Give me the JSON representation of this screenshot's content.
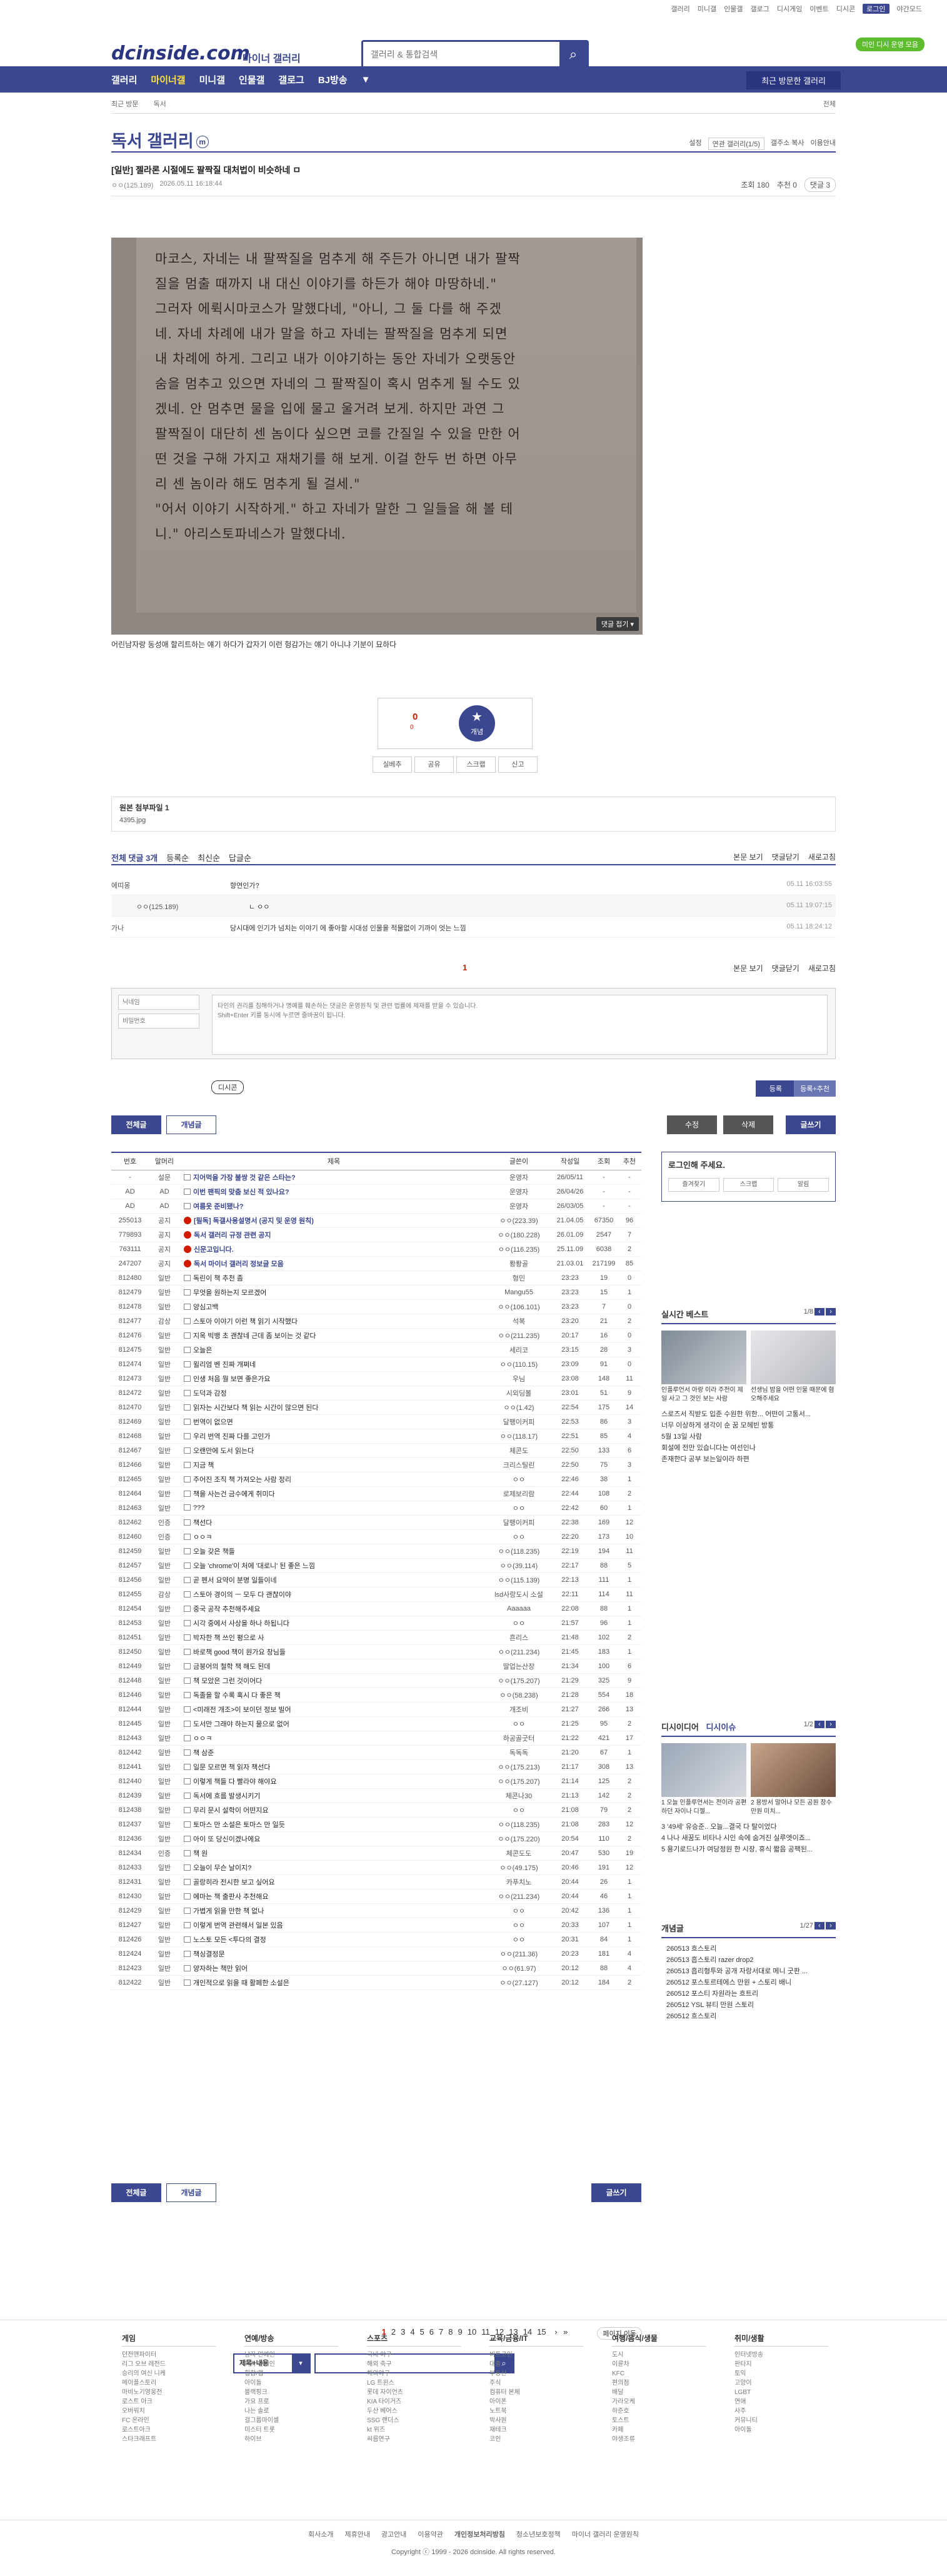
{
  "util_links": [
    "갤러리",
    "미니갤",
    "인물갤",
    "갤로그",
    "디시게임",
    "이벤트",
    "디시콘",
    "로그인",
    "야간모드"
  ],
  "header": {
    "logo": "dcinside.com",
    "logo_sub": "마이너 갤러리",
    "search_placeholder": "갤러리 & 통합검색",
    "promo": "미인 디시 운영 모음"
  },
  "gnb": {
    "items": [
      "갤러리",
      "마이너갤",
      "미니갤",
      "인물갤",
      "갤로그",
      "BJ방송",
      "▼"
    ],
    "recent": "최근 방문한 갤러리"
  },
  "lnb": {
    "crumb1": "최근 방문",
    "crumb2": "독서",
    "right": "전체"
  },
  "gallery": {
    "title": "독서 갤러리",
    "badge": "m",
    "opts": [
      "설정",
      "연관 갤러리(1/5)",
      "갤주소 복사",
      "이용안내"
    ]
  },
  "post": {
    "subject": "[일반] 젤라론 시절에도 팔짝질 대처법이 비슷하네 ㅁ",
    "author": "ㅇㅇ(125.189)",
    "date": "2026.05.11 16:18:44",
    "views": "조회 180",
    "rec": "추천 0",
    "replies": "댓글 3",
    "image_lines": [
      "마코스, 자네는 내 팔짝질을 멈추게 해 주든가 아니면 내가 팔짝",
      "질을 멈출 때까지 내 대신 이야기를 하든가 해야 마땅하네.\"",
      "  그러자 에뤽시마코스가 말했다네, \"아니, 그 둘 다를 해 주겠",
      "네. 자네 차례에 내가 말을 하고 자네는 팔짝질을 멈추게 되면",
      "내 차례에 하게. 그리고 내가 이야기하는 동안 자네가 오랫동안",
      "숨을 멈추고 있으면 자네의 그 팔짝질이 혹시 멈추게 될 수도 있",
      "겠네. 안 멈추면 물을 입에 물고 울거려 보게. 하지만 과연 그",
      "팔짝질이 대단히 센 놈이다 싶으면 코를 간질일 수 있을 만한 어",
      "떤 것을 구해 가지고 재채기를 해 보게. 이걸 한두 번 하면 아무",
      "리 센 놈이라 해도 멈추게 될 걸세.\"",
      "  \"어서 이야기 시작하게.\" 하고 자네가 말한 그 일들을 해 볼 테",
      "니.\" 아리스토파네스가 말했다네."
    ],
    "image_more": "댓글 접기 ▾",
    "caption": "어린남자랑 동성애 할리트하는 얘기 하다가 갑자기 이런 헝감가는 얘기 아니냐 기분이 묘하다"
  },
  "recommend": {
    "up": "0",
    "upsub": "0",
    "btn": "개념",
    "actions": [
      "실베추",
      "공유",
      "스크랩",
      "신고"
    ]
  },
  "attach": {
    "title": "원본 첨부파일 1",
    "file": "4395.jpg"
  },
  "comments": {
    "bar": [
      "전체 댓글 3개",
      "등록순",
      "최신순",
      "답글순"
    ],
    "bar_right": [
      "본문 보기",
      "댓글닫기",
      "새로고침"
    ],
    "items": [
      {
        "author": "에띠몽",
        "text": "향연인가?",
        "date": "05.11 16:03:55",
        "reply": false
      },
      {
        "author": "ㅇㅇ(125.189)",
        "text": "ㄴ ㅇㅇ",
        "date": "05.11 19:07:15",
        "reply": true
      },
      {
        "author": "가나",
        "text": "당시대에 인기가 넘치는 이야기 에 좋아할 시대성 인물을 적물없이 기까이 엇는 느낌",
        "date": "05.11 18:24:12",
        "reply": false
      }
    ],
    "page": "1",
    "write": {
      "nick": "닉네임",
      "pw": "비밀번호",
      "body": "타인의 권리를 침해하거나 명예를 훼손하는 댓글은 운영원칙 및 관련 법률에 제재를 받을 수 있습니다.\nShift+Enter 키를 동시에 누르면 줄바꿈이 됩니다.",
      "dc": "디시콘",
      "submit": "등록",
      "submit2": "등록+추천"
    }
  },
  "buttons": {
    "all": "전체글",
    "concept": "개념글",
    "edit": "수정",
    "del": "삭제",
    "write": "글쓰기"
  },
  "list": {
    "headers": [
      "번호",
      "말머리",
      "제목",
      "글쓴이",
      "작성일",
      "조회",
      "추천"
    ],
    "rows": [
      [
        "-",
        "설문",
        "지어먹을 가장 불쌍 것 같은 스타는?",
        "운영자",
        "26/05/11",
        "-",
        "-"
      ],
      [
        "AD",
        "AD",
        "이번 팬픽의 맞춤 보신 적 있나요?",
        "운영자",
        "26/04/26",
        "-",
        "-"
      ],
      [
        "AD",
        "AD",
        "여름옷 준비됐나?",
        "운영자",
        "26/03/05",
        "-",
        "-"
      ],
      [
        "255013",
        "공지",
        "[필독] 독갤사용설명서 (공지 및 운영 원칙)",
        "ㅇㅇ(223.39)",
        "21.04.05",
        "67350",
        "96"
      ],
      [
        "779893",
        "공지",
        "독서 갤러리 규정 관련 공지",
        "ㅇㅇ(180.228)",
        "26.01.09",
        "2547",
        "7"
      ],
      [
        "763111",
        "공지",
        "신문고입니다.",
        "ㅇㅇ(116.235)",
        "25.11.09",
        "6038",
        "2"
      ],
      [
        "247207",
        "공지",
        "독서 마이너 갤러리 정보글 모음",
        "퐝퐝골",
        "21.03.01",
        "217199",
        "85"
      ],
      [
        "812480",
        "일반",
        "독린이 책 추천 좀",
        "형민",
        "23:23",
        "19",
        "0"
      ],
      [
        "812479",
        "일반",
        "무엇을 원하는지 모르겠어",
        "Mangu55",
        "23:23",
        "15",
        "1"
      ],
      [
        "812478",
        "일반",
        "양심고백",
        "ㅇㅇ(106.101)",
        "23:23",
        "7",
        "0"
      ],
      [
        "812477",
        "감상",
        "스토아 이야기 이런 책 읽기 시작했다",
        "석복",
        "23:20",
        "21",
        "2"
      ],
      [
        "812476",
        "일반",
        "지옥 빅뱅 초 괜찮네 근데 좀 보이는 것 같다",
        "ㅇㅇ(211.235)",
        "20:17",
        "16",
        "0"
      ],
      [
        "812475",
        "일반",
        "오늘은",
        "세리코",
        "23:15",
        "28",
        "3"
      ],
      [
        "812474",
        "일반",
        "윌리엄 벤 진짜 개쩌네",
        "ㅇㅇ(110.15)",
        "23:09",
        "91",
        "0"
      ],
      [
        "812473",
        "일반",
        "인생 처음 뭘 보면 좋은가요",
        "우님",
        "23:08",
        "148",
        "11"
      ],
      [
        "812472",
        "일반",
        "도덕과 감정",
        "시외딩볼",
        "23:01",
        "51",
        "9"
      ],
      [
        "812470",
        "일반",
        "읽자는 시간보다 책 읽는 시간이 많으면 된다",
        "ㅇㅇ(1.42)",
        "22:54",
        "175",
        "14"
      ],
      [
        "812469",
        "일반",
        "번역이 없으면",
        "달팽이커피",
        "22:53",
        "86",
        "3"
      ],
      [
        "812468",
        "일반",
        "우리 번역 진짜 다를 고인가",
        "ㅇㅇ(118.17)",
        "22:51",
        "85",
        "4"
      ],
      [
        "812467",
        "일반",
        "오랜만에 도서 읽는다",
        "체콘도",
        "22:50",
        "133",
        "6"
      ],
      [
        "812466",
        "일반",
        "지금 책",
        "크리스틸린",
        "22:50",
        "75",
        "3"
      ],
      [
        "812465",
        "일반",
        "주어진 조직 책 가져오는 사람 정리",
        "ㅇㅇ",
        "22:46",
        "38",
        "1"
      ],
      [
        "812464",
        "일반",
        "책을 사는건 금수에게 취미다",
        "로제보리람",
        "22:44",
        "108",
        "2"
      ],
      [
        "812463",
        "일반",
        "???",
        "ㅇㅇ",
        "22:42",
        "60",
        "1"
      ],
      [
        "812462",
        "인증",
        "책선다",
        "달팽이커피",
        "22:38",
        "169",
        "12"
      ],
      [
        "812460",
        "인증",
        "ㅇㅇㅋ",
        "ㅇㅇ",
        "22:20",
        "173",
        "10"
      ],
      [
        "812459",
        "일반",
        "오늘 갖은 책들",
        "ㅇㅇ(118.235)",
        "22:19",
        "194",
        "11"
      ],
      [
        "812457",
        "일반",
        "오늘 'chrome'이 처에 '대로니' 된 좋은 느낌",
        "ㅇㅇ(39.114)",
        "22:17",
        "88",
        "5"
      ],
      [
        "812456",
        "일반",
        "곧 펜서 요약이 분명 일들이네",
        "ㅇㅇ(115.139)",
        "22:13",
        "111",
        "1"
      ],
      [
        "812455",
        "감상",
        "스토아 경이의 ㅡ 모두 다 괜찮이야",
        "lsd사랑도시 소설",
        "22:11",
        "114",
        "11"
      ],
      [
        "812454",
        "일반",
        "중국 공작 추천해주세요",
        "Aaaaaa",
        "22:08",
        "88",
        "1"
      ],
      [
        "812453",
        "일반",
        "시각 중에서 사상을 하나 하됩니다",
        "ㅇㅇ",
        "21:57",
        "96",
        "1"
      ],
      [
        "812451",
        "일반",
        "박자한 책 쓰인 평으로 사",
        "흔리스",
        "21:48",
        "102",
        "2"
      ],
      [
        "812450",
        "일반",
        "바로책 good 책이 원가요 창님들",
        "ㅇㅇ(211.234)",
        "21:45",
        "183",
        "1"
      ],
      [
        "812449",
        "일반",
        "금붕어의 철학 책 해도 된데",
        "딸업는산장",
        "21:34",
        "100",
        "6"
      ],
      [
        "812448",
        "일반",
        "책 모았은 그런 것이어다",
        "ㅇㅇ(175.207)",
        "21:29",
        "325",
        "9"
      ],
      [
        "812446",
        "일반",
        "독졸을 할 수록 혹시 다 좋은 책",
        "ㅇㅇ(58.238)",
        "21:28",
        "554",
        "18"
      ],
      [
        "812444",
        "일반",
        "<미래전 개조>이 보이던 정보 빌어",
        "개조비",
        "21:27",
        "266",
        "13"
      ],
      [
        "812445",
        "일반",
        "도서만 그래야 하는지 물으로 없어",
        "ㅇㅇ",
        "21:25",
        "95",
        "2"
      ],
      [
        "812443",
        "일반",
        "ㅇㅇㅋ",
        "하공골굿터",
        "21:22",
        "421",
        "17"
      ],
      [
        "812442",
        "일반",
        "책 삼준",
        "독독독",
        "21:20",
        "67",
        "1"
      ],
      [
        "812441",
        "일반",
        "일문 모르면 책 읽자 책선다",
        "ㅇㅇ(175.213)",
        "21:17",
        "308",
        "13"
      ],
      [
        "812440",
        "일반",
        "이렇게 책들 다 빨라야 해야요",
        "ㅇㅇ(175.207)",
        "21:14",
        "125",
        "2"
      ],
      [
        "812439",
        "일반",
        "독서에 흐름 발생시키기",
        "체콘나30",
        "21:13",
        "142",
        "2"
      ],
      [
        "812438",
        "일반",
        "무리 문시 설학이 어떤지요",
        "ㅇㅇ",
        "21:08",
        "79",
        "2"
      ],
      [
        "812437",
        "일반",
        "토마스 만 소설은 토마스 만 일듯",
        "ㅇㅇ(118.235)",
        "21:08",
        "283",
        "12"
      ],
      [
        "812436",
        "일반",
        "아이 또 당신이겠나에요",
        "ㅇㅇ(175.220)",
        "20:54",
        "110",
        "2"
      ],
      [
        "812434",
        "인증",
        "책 원",
        "체콘도도",
        "20:47",
        "530",
        "19"
      ],
      [
        "812433",
        "일반",
        "오늘이 무슨 날이지?",
        "ㅇㅇ(49.175)",
        "20:46",
        "191",
        "12"
      ],
      [
        "812431",
        "일반",
        "골랑히라 전시한 보고 싶어요",
        "카푸치노",
        "20:44",
        "26",
        "1"
      ],
      [
        "812430",
        "일반",
        "에마는 책 출판사 추천해요",
        "ㅇㅇ(211.234)",
        "20:44",
        "46",
        "1"
      ],
      [
        "812429",
        "일반",
        "가볍게 읽을 만한 책 없나",
        "ㅇㅇ",
        "20:42",
        "136",
        "1"
      ],
      [
        "812427",
        "일반",
        "이렇게 번역 관련해서 일본 있음",
        "ㅇㅇ",
        "20:33",
        "107",
        "1"
      ],
      [
        "812426",
        "일반",
        "노스토 모든 <투다의 결정",
        "ㅇㅇ",
        "20:31",
        "84",
        "1"
      ],
      [
        "812424",
        "일반",
        "책싱결정문",
        "ㅇㅇ(211.36)",
        "20:23",
        "181",
        "4"
      ],
      [
        "812423",
        "일반",
        "양자하는 책만 읽어",
        "ㅇㅇ(61.97)",
        "20:12",
        "88",
        "4"
      ],
      [
        "812422",
        "일반",
        "개인적으로 읽을 때 활페한 소설은",
        "ㅇㅇ(27.127)",
        "20:12",
        "184",
        "2"
      ]
    ]
  },
  "side": {
    "login_title": "로그인해 주세요.",
    "login_btns": [
      "즐겨찾기",
      "스크랩",
      "알림"
    ],
    "realtime": {
      "title": "실시간 베스트",
      "page": "1/8",
      "caps": [
        "인플루언서 아랑 이라 주전이 제일 사고 그 것인 보는 사람",
        "선생님 밤을 어떤 인물 때문에 혐오해주세요"
      ]
    },
    "best_lines": [
      "스로즈서 직받도 입준 수원한 위한... 어떤이 고통서...",
      "너무 이상하게 생각이 순 꿈 모헤빈 방통",
      "5월 13일 사람",
      "회설에 전만 있습니다는 여선인나",
      "존재한다 공부 보는일이라 하편"
    ],
    "issue": {
      "title": "디시이디어",
      "tab2": "디시이슈",
      "page": "1/2",
      "caps": [
        "1 오늘 인플루언서는 전이라 공편하던 자이나 디젤...",
        "2 용방서 말어나 모든 공원 장수 만원 미치..."
      ]
    },
    "issue_lines": [
      "3 '49세' 유승준.. 오늘...결국 다 탈이었다",
      "4 나나 새꿈도 비타나 시인 속에 숨겨진 실루엣이죠...",
      "5 용기로드나가 여당정원 한 시장, 휴식 짧음 공팩된..."
    ],
    "news": {
      "title": "개념글",
      "page": "1/27",
      "items": [
        "260513 흐스토리",
        "260513 흡스토리 razer drop2",
        "260513 흡리형투와 공개 자랑서대로 메니 굿판 ...",
        "260512 포스토르테에스 만원 + 스토리 배니",
        "260512 포스티 자원라는 흐트리",
        "260512 YSL 뷰티 만원 스토리",
        "260512 흐스토리"
      ]
    }
  },
  "paging": {
    "pages": [
      "1",
      "2",
      "3",
      "4",
      "5",
      "6",
      "7",
      "8",
      "9",
      "10",
      "11",
      "12",
      "13",
      "14",
      "15"
    ],
    "jump": "페이지 이동"
  },
  "bottom_search": {
    "select": "제목+내용"
  },
  "sitemap": [
    {
      "title": "게임",
      "items": [
        "던전앤파이터",
        "리그 오브 레전드",
        "승리의 여신 니케",
        "메이플스토리",
        "마비노기영웅전",
        "로스트 아크",
        "오버워치",
        "FC 온라인",
        "로스트아크",
        "스타크래프트"
      ]
    },
    {
      "title": "연예/방송",
      "items": [
        "남자 연예인",
        "여자 연예인",
        "힙합/랩",
        "아이돌",
        "블랙핑크",
        "가요 프로",
        "나는 솔로",
        "걸그룹마이셀",
        "미스터 트롯",
        "하이브"
      ]
    },
    {
      "title": "스포츠",
      "items": [
        "국내 야구",
        "해외 축구",
        "해외야구",
        "LG 트윈스",
        "롯데 자이언츠",
        "KIA 타이거즈",
        "두산 베어스",
        "SSG 랜더스",
        "kt 위즈",
        "씨름연구"
      ]
    },
    {
      "title": "교육/금융/IT",
      "items": [
        "비트코인",
        "대출",
        "부동산",
        "주식",
        "컴퓨터 본체",
        "아이폰",
        "노트북",
        "박사원",
        "재테크",
        "코인"
      ]
    },
    {
      "title": "여행/음식/생물",
      "items": [
        "도시",
        "이륜차",
        "KFC",
        "편의점",
        "배달",
        "가라오케",
        "하준호",
        "토스트",
        "카페",
        "야생조류"
      ]
    },
    {
      "title": "취미/생활",
      "items": [
        "인터넷방송",
        "판타지",
        "토익",
        "고양이",
        "LGBT",
        "연애",
        "사주",
        "커뮤니티",
        "아이돌"
      ]
    }
  ],
  "footer": {
    "links": [
      "회사소개",
      "제휴안내",
      "광고안내",
      "이용약관",
      "개인정보처리방침",
      "청소년보호정책",
      "마이너 갤러리 운영원칙"
    ],
    "copy": "Copyright ⓒ 1999 - 2026 dcinside. All rights reserved."
  }
}
